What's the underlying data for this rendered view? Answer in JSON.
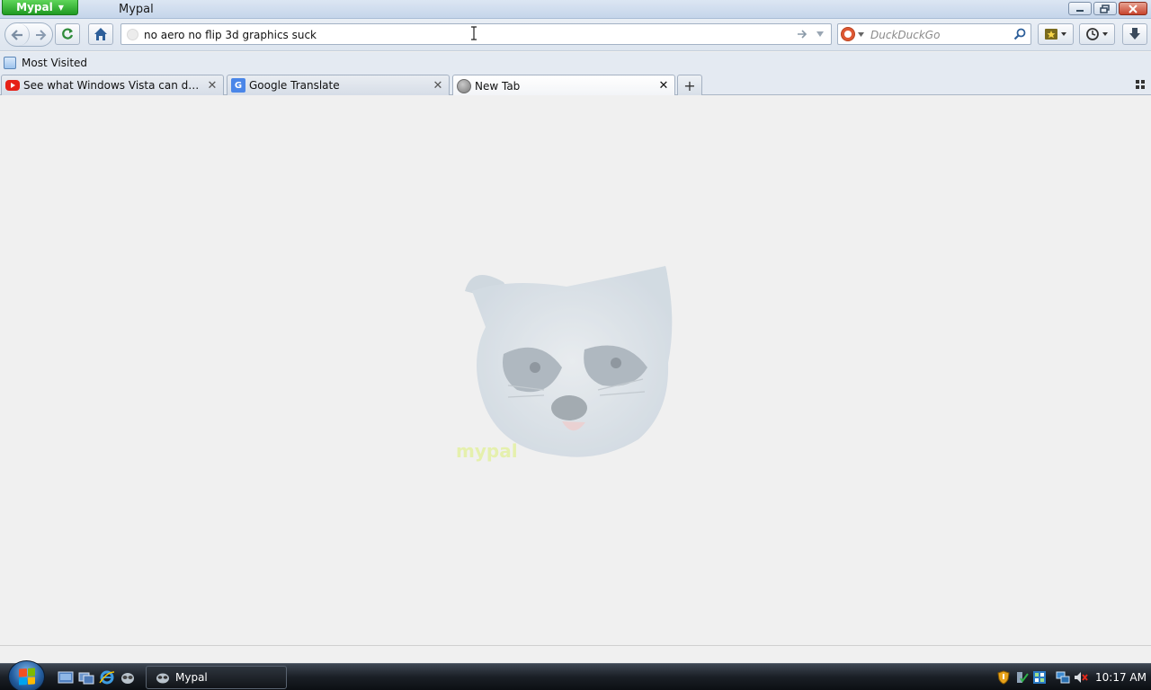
{
  "window": {
    "app_menu_label": "Mypal",
    "title": "Mypal"
  },
  "navigation": {
    "url_value": "no aero no flip 3d graphics suck",
    "search_placeholder": "DuckDuckGo",
    "search_engine_icon": "duckduckgo-icon"
  },
  "bookmarks": {
    "items": [
      {
        "label": "Most Visited",
        "icon": "bookmark-folder-icon"
      }
    ]
  },
  "tabs": [
    {
      "label": "See what Windows Vista can do: Vista...",
      "icon": "youtube-icon",
      "active": false
    },
    {
      "label": "Google Translate",
      "icon": "google-translate-icon",
      "active": false
    },
    {
      "label": "New Tab",
      "icon": "globe-icon",
      "active": true
    }
  ],
  "new_tab_page": {
    "logo_text": "mypal"
  },
  "taskbar": {
    "task_label": "Mypal",
    "clock": "10:17 AM"
  },
  "colors": {
    "app_menu_green": "#2aa52c",
    "taskbar_dark": "#1a1f26",
    "content_bg": "#f0f0f0"
  }
}
